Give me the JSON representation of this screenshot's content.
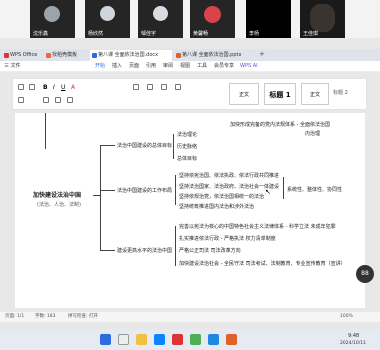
{
  "video_strip": {
    "tiles": [
      {
        "name": "沈乐鑫"
      },
      {
        "name": "杨欣然"
      },
      {
        "name": "邹佳宇"
      },
      {
        "name": "黄馨畅"
      },
      {
        "name": "李杨"
      },
      {
        "name": "王佳琪"
      }
    ]
  },
  "tabs": [
    {
      "label": "WPS Office",
      "color": "#d33"
    },
    {
      "label": "找稻壳模板",
      "color": "#e64"
    },
    {
      "label": "第八课 全面依法治国.docx",
      "color": "#2b6de0"
    },
    {
      "label": "第八课 全面依法治国.pptx",
      "color": "#e0602b"
    }
  ],
  "menubar": {
    "file": "三 文件",
    "tabs": [
      "开始",
      "插入",
      "页面",
      "引用",
      "审阅",
      "视图",
      "工具",
      "会员专享",
      "WPS AI"
    ]
  },
  "ribbon": {
    "font_size_box": "正文",
    "heading_style": "标题 1",
    "normal_style": "正文",
    "heading2_style": "标题 2"
  },
  "mindmap": {
    "top_text_1": "加快形成完备的党内法规体系 - 全面依法治国",
    "top_text_2": "内治理",
    "root": "加快建设法治中国",
    "root_sub": "(法治、人治、法制)",
    "branch1": "法治中国建设的总体目标",
    "b1_items": [
      "法治理论",
      "历史脉络",
      "总体目标"
    ],
    "branch2": "法治中国建设的工作布局",
    "b2_items": [
      "坚持依宪治国、依法执政、依法行政共同推进",
      "坚持法治国家、法治政府、法治社会一体建设",
      "坚持依规治党，依法治国相统一的法治",
      "坚持统筹推进国内法治和涉外法治"
    ],
    "b2_right": "系统性、整体性、协同性",
    "branch3": "建设更高水平的法治中国",
    "b3_items": [
      "完善以宪法为核心的中国特色社会主义法律体系 - 科学立法  未成年犯罪",
      "扎实推进依法行政 - 严格执法  权力清单制度",
      "严格公正司法  司法改革方向",
      "加快建设法治社会 - 全民守法  司法考试、法制教育、专业宣传教育（宣讲）"
    ]
  },
  "statusbar": {
    "page": "页面: 1/1",
    "words": "字数: 183",
    "spell": "拼写检查: 打开",
    "zoom": "100%"
  },
  "taskbar": {
    "time": "9:48",
    "date": "2024/10/11"
  },
  "float_badge": "88"
}
